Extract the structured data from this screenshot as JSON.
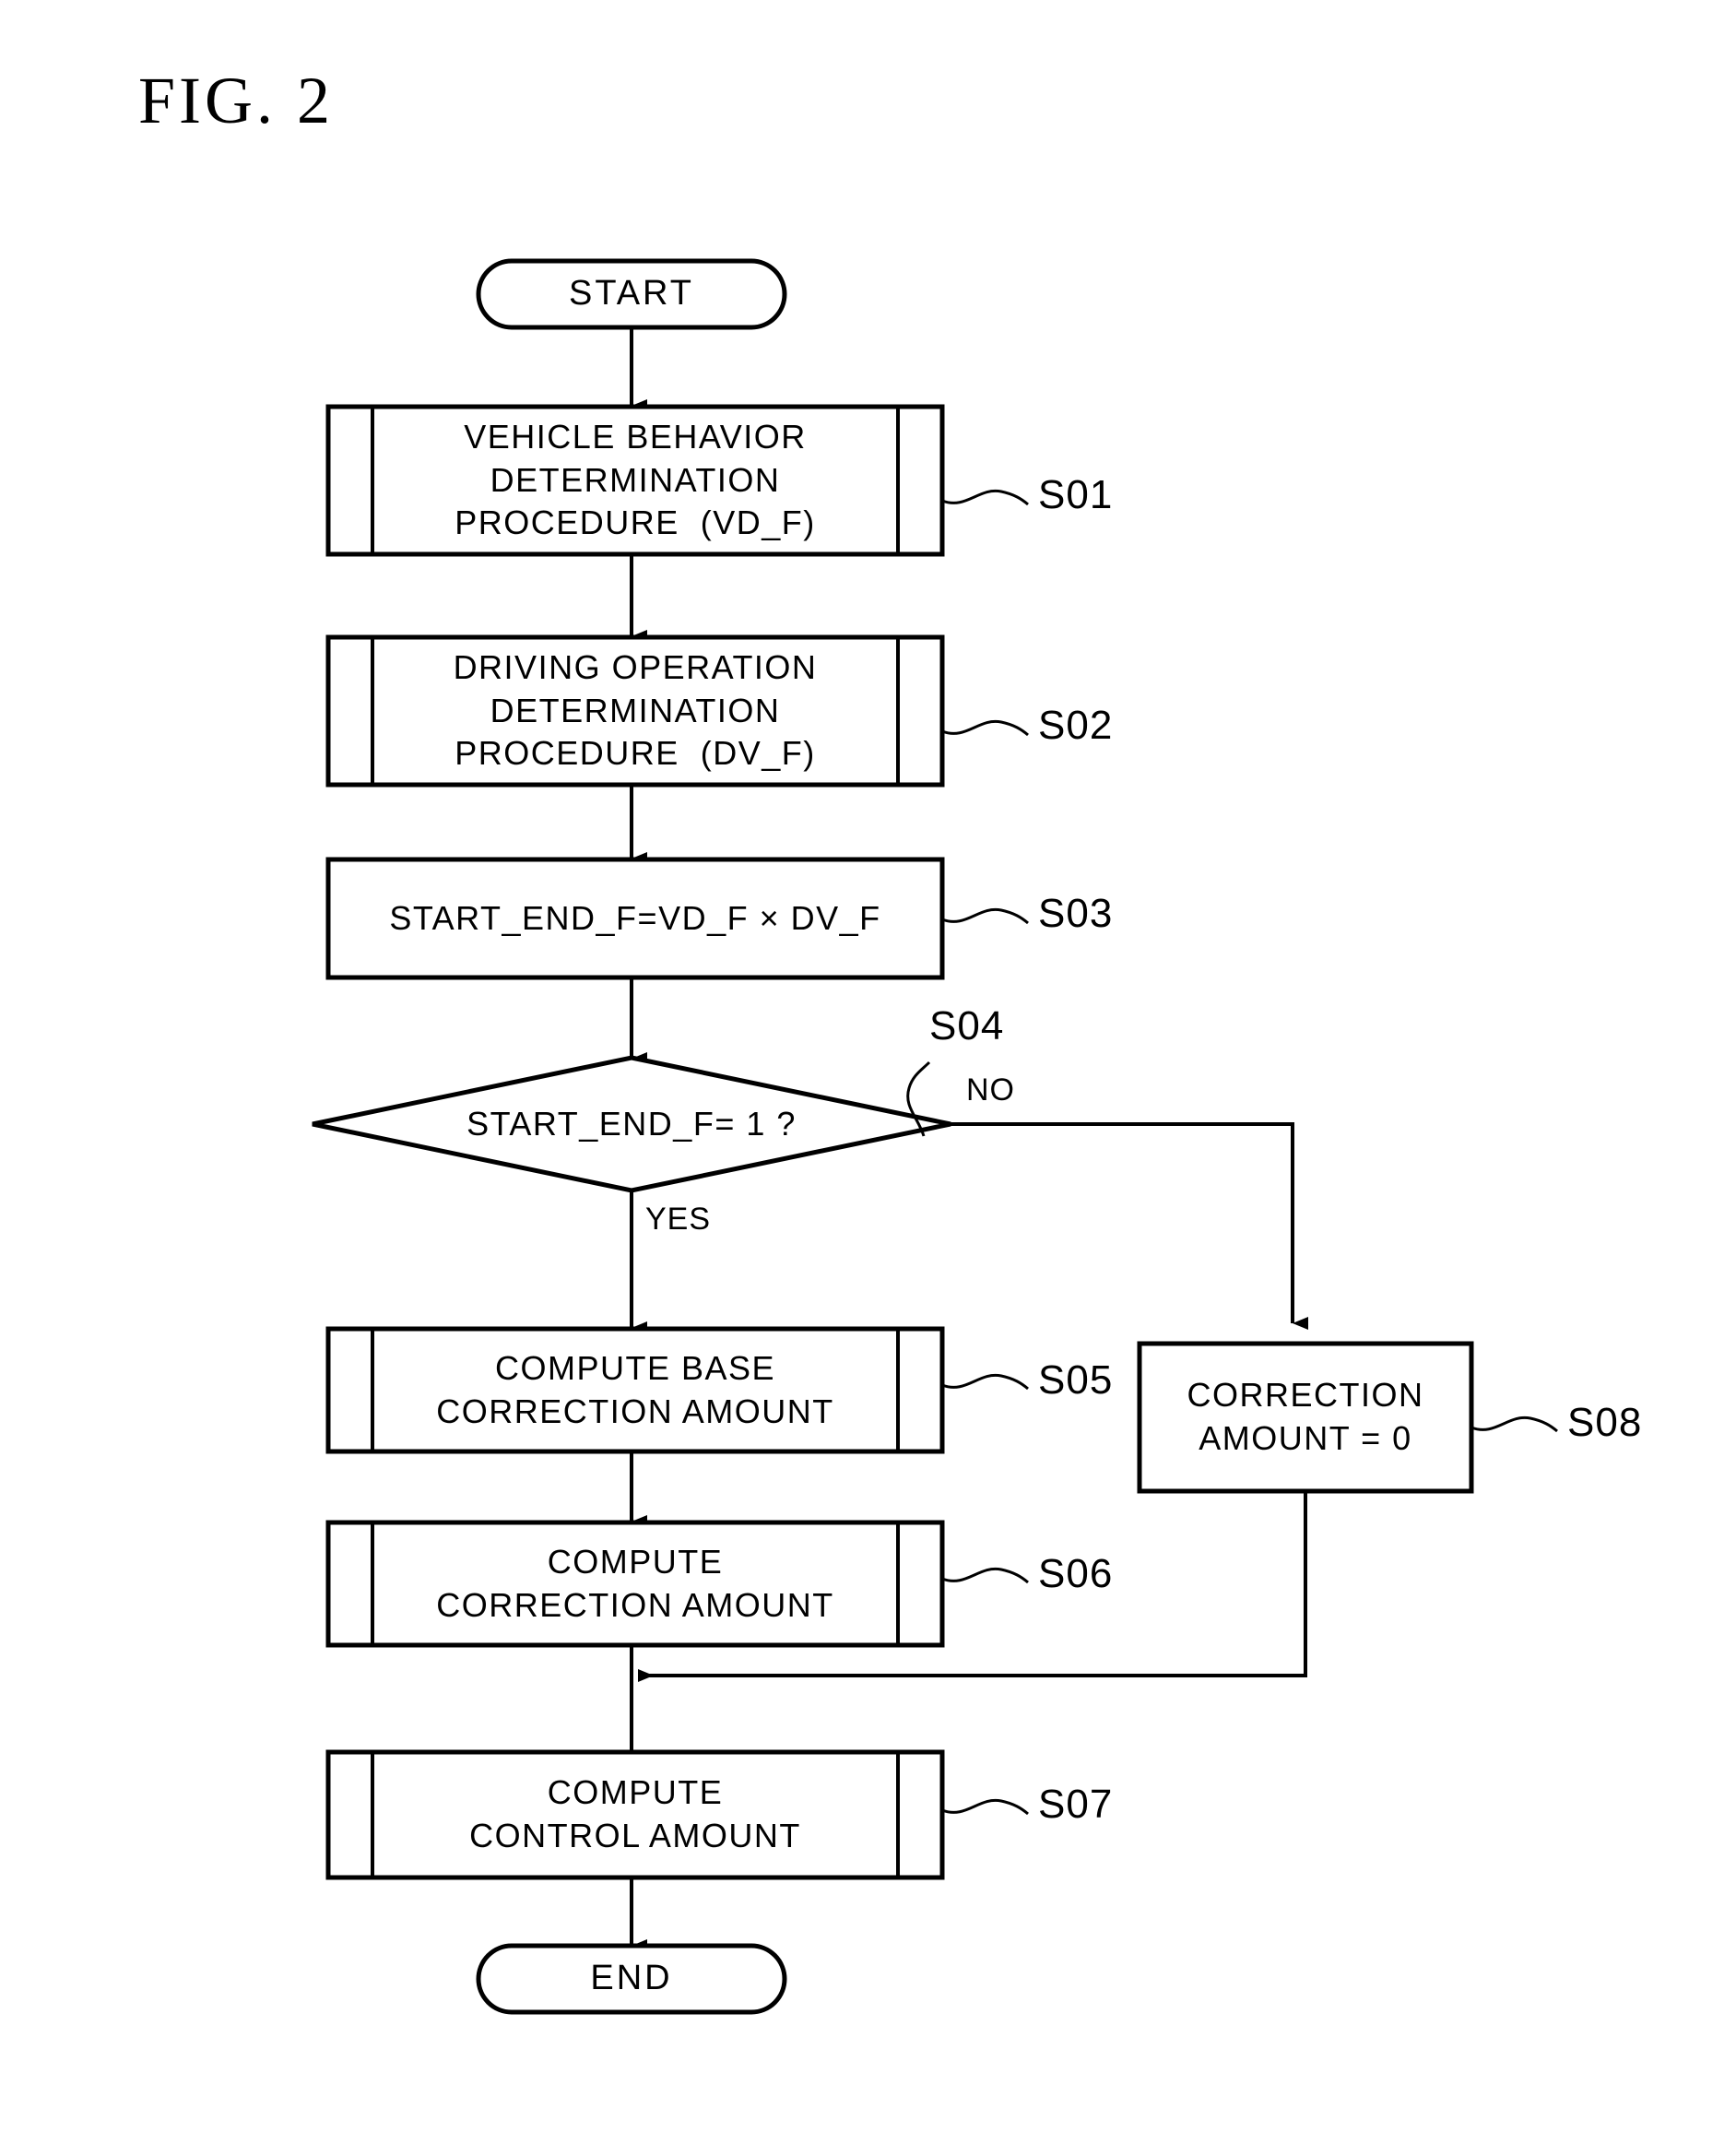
{
  "figure": {
    "title": "FIG. 2",
    "type": "flowchart"
  },
  "nodes": {
    "start": {
      "label": "START",
      "shape": "terminator"
    },
    "s01": {
      "tag": "S01",
      "shape": "predefined-process",
      "line1": "VEHICLE BEHAVIOR",
      "line2": "DETERMINATION",
      "line3": "PROCEDURE  (VD_F)"
    },
    "s02": {
      "tag": "S02",
      "shape": "predefined-process",
      "line1": "DRIVING OPERATION",
      "line2": "DETERMINATION",
      "line3": "PROCEDURE  (DV_F)"
    },
    "s03": {
      "tag": "S03",
      "shape": "process",
      "line1": "START_END_F=VD_F × DV_F"
    },
    "s04": {
      "tag": "S04",
      "shape": "decision",
      "line1": "START_END_F= 1 ?",
      "yes_label": "YES",
      "no_label": "NO"
    },
    "s05": {
      "tag": "S05",
      "shape": "predefined-process",
      "line1": "COMPUTE BASE",
      "line2": "CORRECTION AMOUNT"
    },
    "s06": {
      "tag": "S06",
      "shape": "predefined-process",
      "line1": "COMPUTE",
      "line2": "CORRECTION AMOUNT"
    },
    "s07": {
      "tag": "S07",
      "shape": "predefined-process",
      "line1": "COMPUTE",
      "line2": "CONTROL AMOUNT"
    },
    "s08": {
      "tag": "S08",
      "shape": "process",
      "line1": "CORRECTION",
      "line2": "AMOUNT = 0"
    },
    "end": {
      "label": "END",
      "shape": "terminator"
    }
  },
  "colors": {
    "stroke": "#000000",
    "fill": "#ffffff",
    "text": "#000000"
  }
}
